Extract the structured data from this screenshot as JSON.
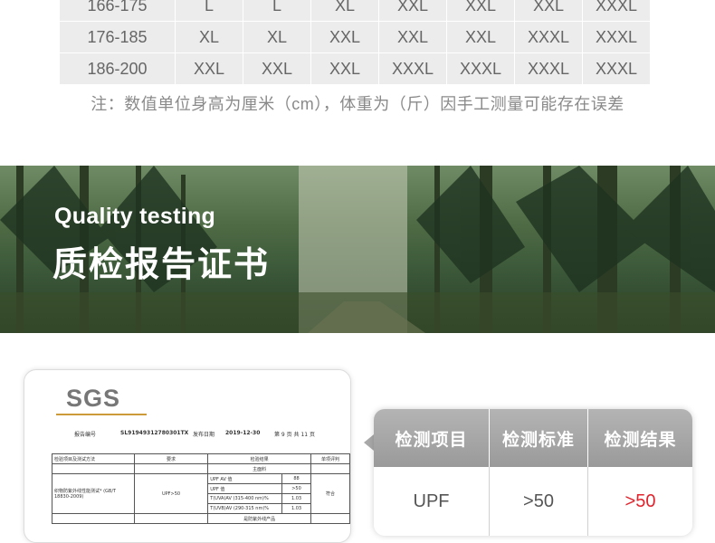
{
  "size_table": {
    "rows": [
      [
        "166-175",
        "L",
        "L",
        "XL",
        "XXL",
        "XXL",
        "XXL",
        "XXXL"
      ],
      [
        "176-185",
        "XL",
        "XL",
        "XXL",
        "XXL",
        "XXL",
        "XXXL",
        "XXXL"
      ],
      [
        "186-200",
        "XXL",
        "XXL",
        "XXL",
        "XXXL",
        "XXXL",
        "XXXL",
        "XXXL"
      ]
    ]
  },
  "note": "注：数值单位身高为厘米（cm），体重为（斤）因手工测量可能存在误差",
  "banner": {
    "title_en": "Quality testing",
    "title_zh": "质检报告证书"
  },
  "certificate": {
    "logo": "SGS",
    "report_no_label": "报告编号",
    "report_no": "SL91949312780301TX",
    "issue_date_label": "发布日期",
    "issue_date": "2019-12-30",
    "page_info": "第 9 页 共 11 页",
    "table": {
      "headers": [
        "检验项目及测试方法",
        "要求",
        "检验结果",
        "单项评判"
      ],
      "subheader": "主面料",
      "item": "织物防紫外线性能测试* (GB/T 18830-2009)",
      "requirement": "UPF>50",
      "verdict": "符合",
      "rows": [
        [
          "UPF AV 值",
          "88"
        ],
        [
          "UPF 值",
          ">50"
        ],
        [
          "T(UVA)AV (315-400 nm)%",
          "1.03"
        ],
        [
          "T(UVB)AV (290-315 nm)%",
          "1.03"
        ]
      ],
      "footer": "是防紫外线产品"
    }
  },
  "results": {
    "headers": [
      "检测项目",
      "检测标准",
      "检测结果"
    ],
    "row": [
      "UPF",
      ">50",
      ">50"
    ],
    "highlight_color": "#e0232c"
  }
}
